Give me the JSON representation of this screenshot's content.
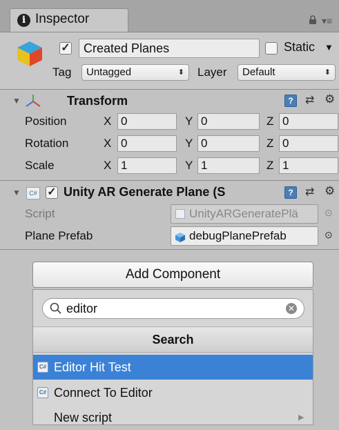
{
  "tab": {
    "label": "Inspector",
    "info_icon": "i"
  },
  "header": {
    "object_name": "Created Planes",
    "active_checked": true,
    "static_label": "Static",
    "tag_label": "Tag",
    "tag_value": "Untagged",
    "layer_label": "Layer",
    "layer_value": "Default"
  },
  "transform": {
    "title": "Transform",
    "rows": [
      {
        "label": "Position",
        "x": "0",
        "y": "0",
        "z": "0"
      },
      {
        "label": "Rotation",
        "x": "0",
        "y": "0",
        "z": "0"
      },
      {
        "label": "Scale",
        "x": "1",
        "y": "1",
        "z": "1"
      }
    ],
    "axis": {
      "x": "X",
      "y": "Y",
      "z": "Z"
    }
  },
  "script_component": {
    "title": "Unity AR Generate Plane (S",
    "script_label": "Script",
    "script_value": "UnityARGeneratePlä",
    "prefab_label": "Plane Prefab",
    "prefab_value": "debugPlanePrefab",
    "cs_badge": "C#"
  },
  "add_component": {
    "button_label": "Add Component",
    "search_value": "editor",
    "search_header": "Search",
    "results": [
      {
        "label": "Editor Hit Test",
        "selected": true
      },
      {
        "label": "Connect To Editor",
        "selected": false
      },
      {
        "label": "New script",
        "selected": false
      }
    ]
  },
  "colors": {
    "selection": "#3b82d6",
    "panel": "#c2c2c2"
  }
}
